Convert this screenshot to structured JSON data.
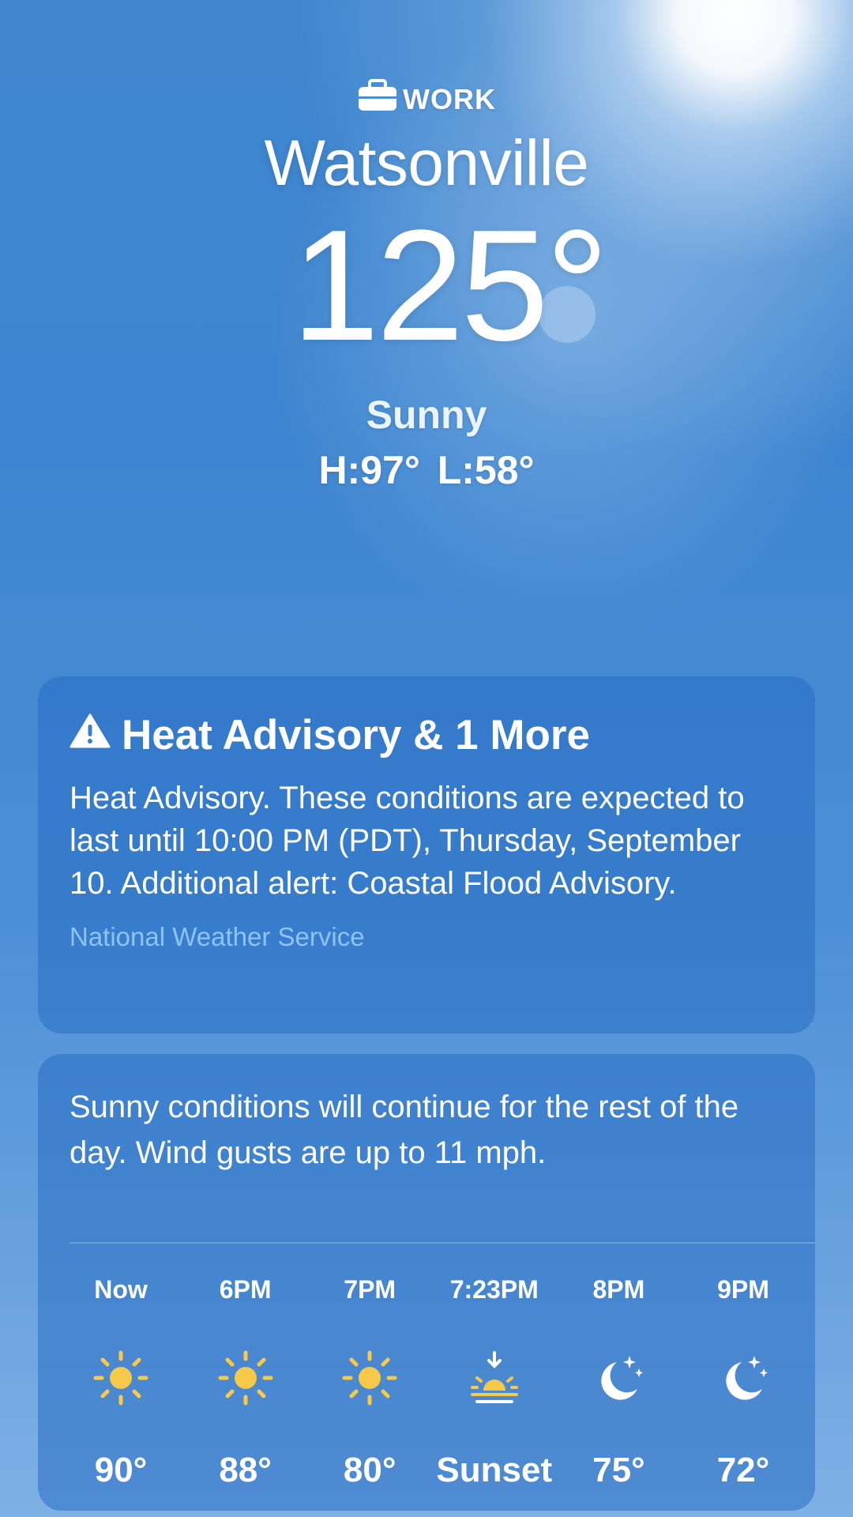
{
  "location": {
    "tag_icon": "briefcase-icon",
    "tag": "WORK",
    "city": "Watsonville"
  },
  "current": {
    "temperature": "125°",
    "condition": "Sunny",
    "high_low": "H:97°  L:58°"
  },
  "alert": {
    "icon": "warning-triangle-icon",
    "title": "Heat Advisory & 1 More",
    "body": "Heat Advisory. These conditions are expected to last until 10:00 PM (PDT), Thursday, September 10. Additional alert: Coastal Flood Advisory.",
    "source": "National Weather Service"
  },
  "forecast": {
    "summary": "Sunny conditions will continue for the rest of the day. Wind gusts are up to 11 mph.",
    "hours": [
      {
        "label": "Now",
        "icon": "sun-icon",
        "value": "90°"
      },
      {
        "label": "6PM",
        "icon": "sun-icon",
        "value": "88°"
      },
      {
        "label": "7PM",
        "icon": "sun-icon",
        "value": "80°"
      },
      {
        "label": "7:23PM",
        "icon": "sunset-icon",
        "value": "Sunset"
      },
      {
        "label": "8PM",
        "icon": "moon-stars-icon",
        "value": "75°"
      },
      {
        "label": "9PM",
        "icon": "moon-stars-icon",
        "value": "72°"
      }
    ]
  },
  "colors": {
    "sun_yellow": "#f7c948",
    "source_link": "#8ec3f5",
    "sky_blue": "#3f86cf"
  }
}
